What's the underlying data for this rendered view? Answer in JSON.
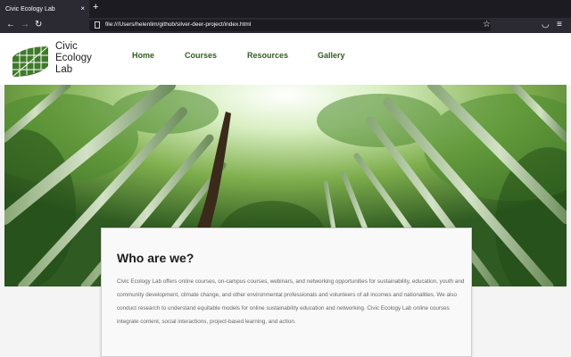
{
  "browser": {
    "tab_title": "Civic Ecology Lab",
    "tab_close": "×",
    "new_tab": "+",
    "url": "file:///Users/helenlim/github/silver-deer-project/index.html"
  },
  "site": {
    "logo_lines": [
      "Civic",
      "Ecology",
      "Lab"
    ],
    "nav": [
      "Home",
      "Courses",
      "Resources",
      "Gallery"
    ]
  },
  "about": {
    "heading": "Who are we?",
    "body": "Civic Ecology Lab offers online courses, on-campus courses, webinars, and networking opportunities for sustainability, education, youth and community development, climate change, and other environmental professionals and volunteers of all incomes and nationalities. We also conduct research to understand equitable models for online sustainability education and networking. Civic Ecology Lab online courses integrate content, social interactions, project-based learning, and action."
  },
  "colors": {
    "brand_green": "#2f5e1e",
    "logo_green": "#3f7a2a"
  }
}
